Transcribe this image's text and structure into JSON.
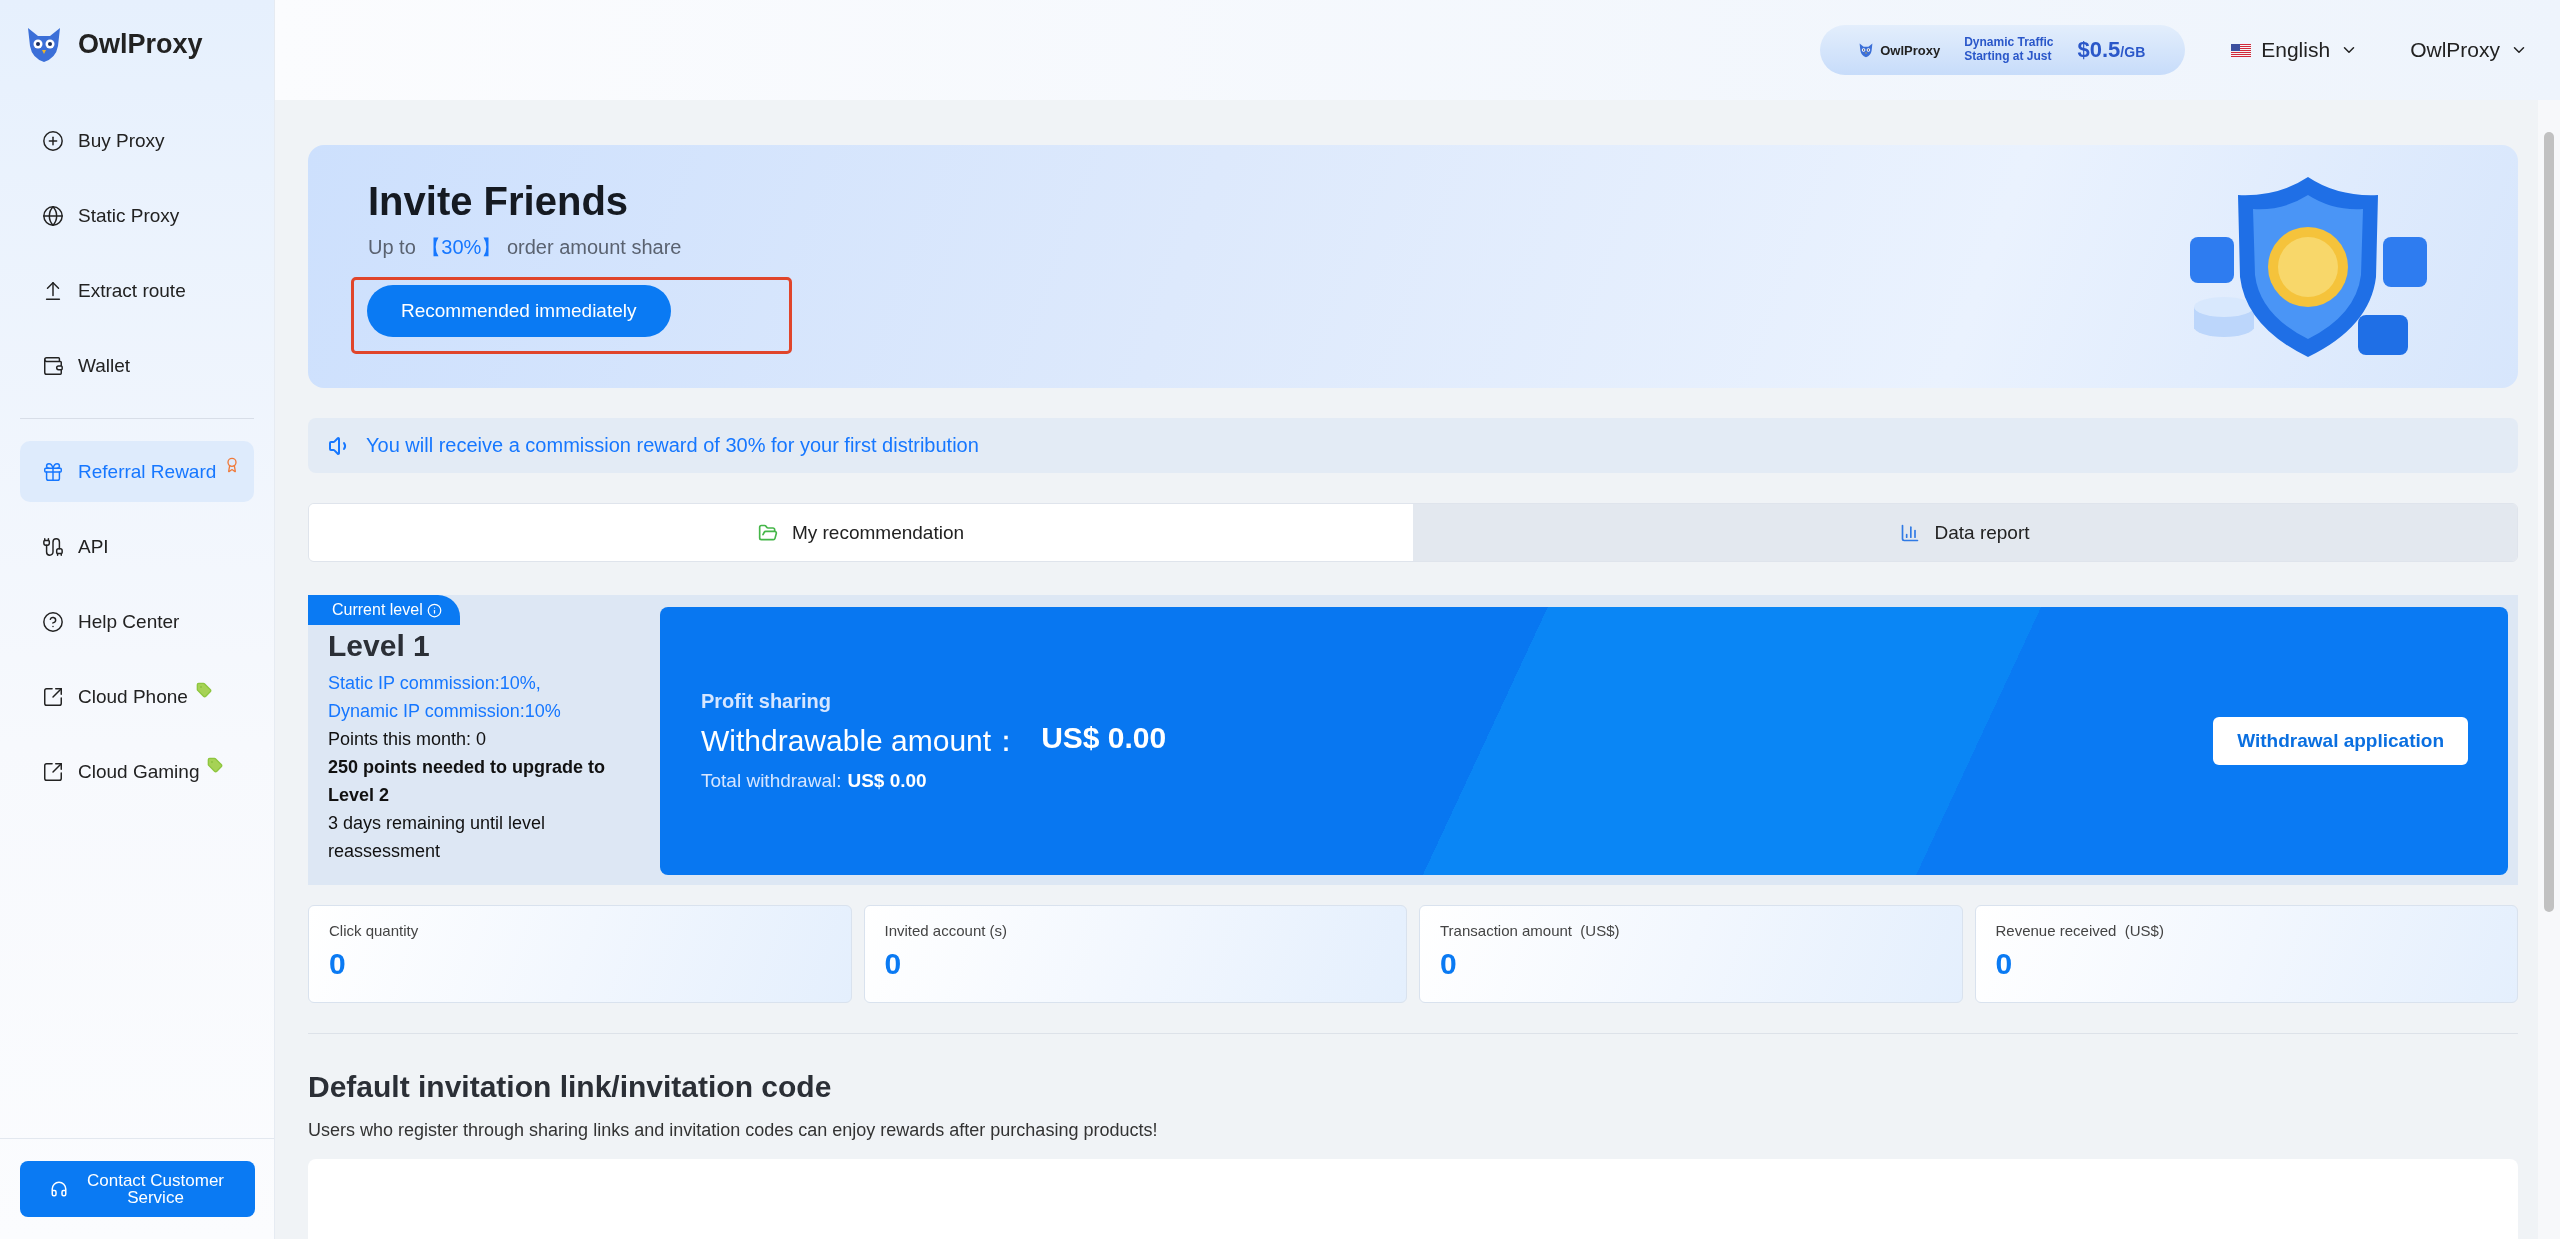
{
  "brand": {
    "name": "OwlProxy"
  },
  "sidebar": {
    "items": [
      {
        "label": "Buy Proxy",
        "selected": false
      },
      {
        "label": "Static Proxy",
        "selected": false
      },
      {
        "label": "Extract route",
        "selected": false
      },
      {
        "label": "Wallet",
        "selected": false
      },
      {
        "label": "Referral Reward",
        "selected": true
      },
      {
        "label": "API",
        "selected": false
      },
      {
        "label": "Help Center",
        "selected": false
      },
      {
        "label": "Cloud Phone",
        "selected": false
      },
      {
        "label": "Cloud Gaming",
        "selected": false
      }
    ],
    "contact_button": "Contact Customer Service"
  },
  "topbar": {
    "promo": {
      "brand": "OwlProxy",
      "line1": "Dynamic Traffic",
      "line2": "Starting at Just",
      "price": "$0.5",
      "unit": "/GB"
    },
    "language": "English",
    "account": "OwlProxy"
  },
  "banner": {
    "title": "Invite Friends",
    "subtitle_before": "Up to ",
    "subtitle_highlight": "【30%】",
    "subtitle_after": " order amount share",
    "button": "Recommended immediately",
    "button_highlighted": true
  },
  "notice": "You will receive a commission reward of 30% for your first distribution",
  "tabs": [
    {
      "label": "My recommendation",
      "selected": true
    },
    {
      "label": "Data report",
      "selected": false
    }
  ],
  "level": {
    "badge": "Current level",
    "name": "Level 1",
    "commissions": [
      "Static IP commission:10%,",
      "Dynamic IP commission:10%"
    ],
    "points": "Points this month: 0",
    "upgrade": "250 points needed to upgrade to Level 2",
    "remaining": "3 days remaining until level reassessment"
  },
  "profit": {
    "title": "Profit sharing",
    "label": "Withdrawable amount：",
    "amount": "US$ 0.00",
    "total_label": "Total withdrawal:",
    "total": "US$ 0.00",
    "button": "Withdrawal application"
  },
  "stats": [
    {
      "label": "Click quantity",
      "value": "0"
    },
    {
      "label": "Invited account (s)",
      "value": "0"
    },
    {
      "label": "Transaction amount  (US$)",
      "value": "0"
    },
    {
      "label": "Revenue received  (US$)",
      "value": "0"
    }
  ],
  "invitation": {
    "heading": "Default invitation link/invitation code",
    "description": "Users who register through sharing links and invitation codes can enjoy rewards after purchasing products!"
  }
}
